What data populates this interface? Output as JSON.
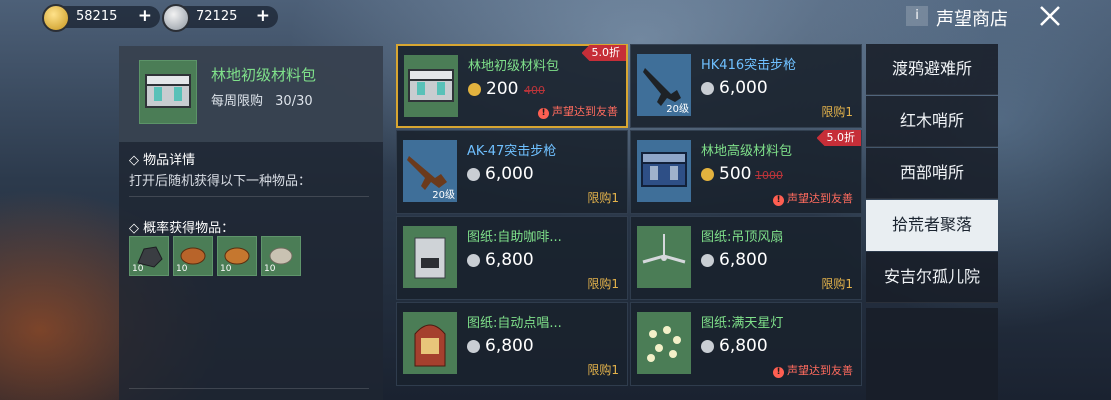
{
  "currency": {
    "gold": {
      "amount": "58215",
      "plus": "+"
    },
    "silver": {
      "amount": "72125",
      "plus": "+"
    }
  },
  "header": {
    "info": "i",
    "title": "声望商店"
  },
  "detail": {
    "name": "林地初级材料包",
    "limit_label": "每周限购",
    "limit_value": "30/30",
    "section1_title": "◇ 物品详情",
    "section1_text": "打开后随机获得以下一种物品：",
    "section2_title": "◇ 概率获得物品：",
    "drops": [
      {
        "count": "10"
      },
      {
        "count": "10"
      },
      {
        "count": "10"
      },
      {
        "count": "10"
      }
    ]
  },
  "items": [
    {
      "name": "林地初级材料包",
      "price": "200",
      "old_price": "400",
      "discount": "5.0折",
      "note": "声望达到友善",
      "currency": "gold"
    },
    {
      "name": "HK416突击步枪",
      "price": "6,000",
      "level": "20级",
      "limit": "限购1",
      "currency": "silver"
    },
    {
      "name": "AK-47突击步枪",
      "price": "6,000",
      "level": "20级",
      "limit": "限购1",
      "currency": "silver"
    },
    {
      "name": "林地高级材料包",
      "price": "500",
      "old_price": "1000",
      "discount": "5.0折",
      "note": "声望达到友善",
      "currency": "gold"
    },
    {
      "name": "图纸:自助咖啡...",
      "price": "6,800",
      "limit": "限购1",
      "currency": "silver"
    },
    {
      "name": "图纸:吊顶风扇",
      "price": "6,800",
      "limit": "限购1",
      "currency": "silver"
    },
    {
      "name": "图纸:自动点唱...",
      "price": "6,800",
      "limit": "限购1",
      "currency": "silver"
    },
    {
      "name": "图纸:满天星灯",
      "price": "6,800",
      "note": "声望达到友善",
      "currency": "silver"
    }
  ],
  "tabs": [
    {
      "label": "渡鸦避难所"
    },
    {
      "label": "红木哨所"
    },
    {
      "label": "西部哨所"
    },
    {
      "label": "拾荒者聚落",
      "active": true
    },
    {
      "label": "安吉尔孤儿院"
    }
  ],
  "colors": {
    "accent_gold": "#d8a631",
    "green_name": "#7fe08a",
    "red_note": "#ff6b5e",
    "limit_yellow": "#e3b24b"
  }
}
